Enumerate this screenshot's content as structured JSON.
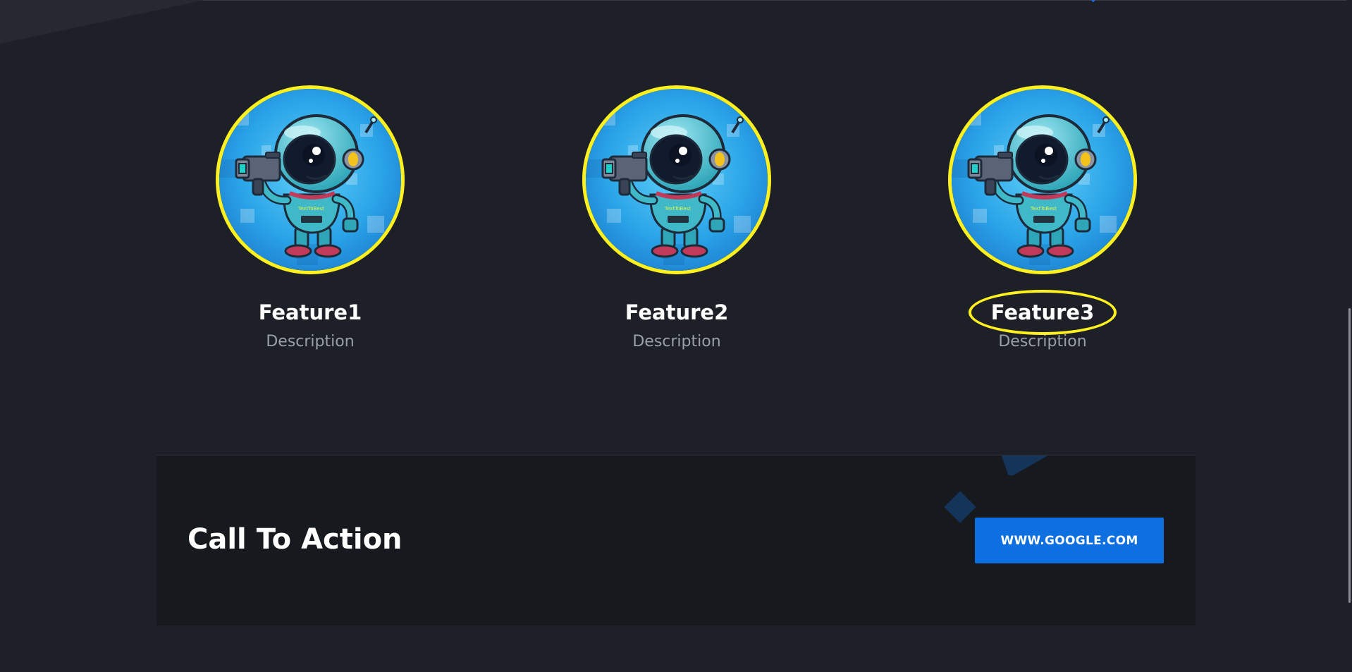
{
  "features": [
    {
      "title": "Feature1",
      "description": "Description",
      "image_icon": "robot-astronaut-camera-icon"
    },
    {
      "title": "Feature2",
      "description": "Description",
      "image_icon": "robot-astronaut-camera-icon"
    },
    {
      "title": "Feature3",
      "description": "Description",
      "image_icon": "robot-astronaut-camera-icon",
      "highlighted": true
    }
  ],
  "cta": {
    "title": "Call To Action",
    "button_label": "WWW.GOOGLE.COM"
  },
  "colors": {
    "background": "#1e2027",
    "cta_background": "#16191e",
    "accent_ring": "#fff01f",
    "button": "#0d6fe0",
    "description_text": "#9aa0a9"
  }
}
